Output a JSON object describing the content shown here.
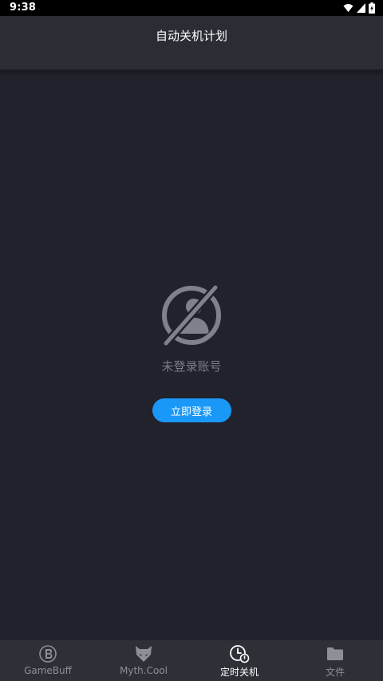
{
  "status_bar": {
    "time": "9:38",
    "icons": [
      "wifi-icon",
      "signal-icon",
      "battery-icon"
    ]
  },
  "header": {
    "title": "自动关机计划"
  },
  "empty_state": {
    "icon": "no-account-icon",
    "message": "未登录账号",
    "login_label": "立即登录"
  },
  "bottom_nav": {
    "items": [
      {
        "label": "GameBuff",
        "icon": "gamebuff-logo-icon",
        "active": false
      },
      {
        "label": "Myth.Cool",
        "icon": "fox-logo-icon",
        "active": false
      },
      {
        "label": "定时关机",
        "icon": "timer-clock-icon",
        "active": true
      },
      {
        "label": "文件",
        "icon": "folder-icon",
        "active": false
      }
    ]
  },
  "colors": {
    "background": "#21222b",
    "header": "#2b2c34",
    "accent": "#1a98f8",
    "nav_background": "#2e2f37",
    "muted_text": "#7c7d86"
  }
}
